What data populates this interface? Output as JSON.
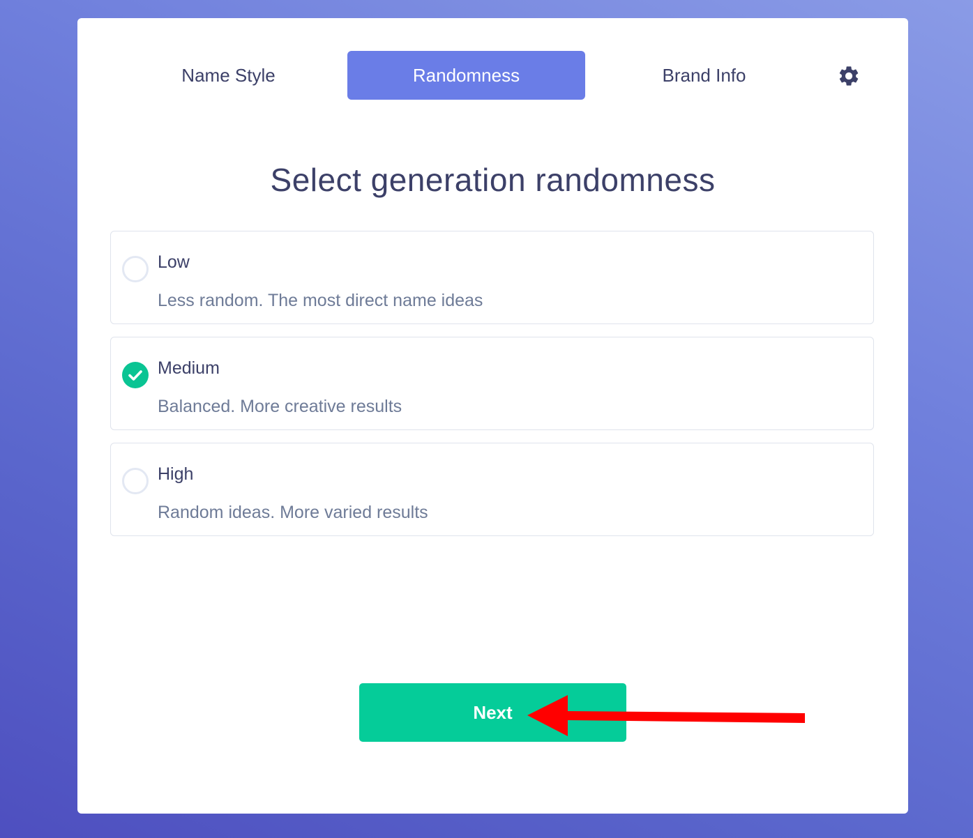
{
  "tabs": [
    {
      "label": "Name Style",
      "active": false
    },
    {
      "label": "Randomness",
      "active": true
    },
    {
      "label": "Brand Info",
      "active": false
    }
  ],
  "settings_icon": "gear-icon",
  "heading": "Select generation randomness",
  "options": [
    {
      "title": "Low",
      "description": "Less random. The most direct name ideas",
      "selected": false
    },
    {
      "title": "Medium",
      "description": "Balanced. More creative results",
      "selected": true
    },
    {
      "title": "High",
      "description": "Random ideas. More varied results",
      "selected": false
    }
  ],
  "next_button": {
    "label": "Next"
  },
  "colors": {
    "active_tab": "#6a7de7",
    "accent_green": "#05cc99",
    "annotation_arrow": "#ff0000",
    "text_dark": "#3c4068",
    "text_muted": "#6e7b97"
  }
}
